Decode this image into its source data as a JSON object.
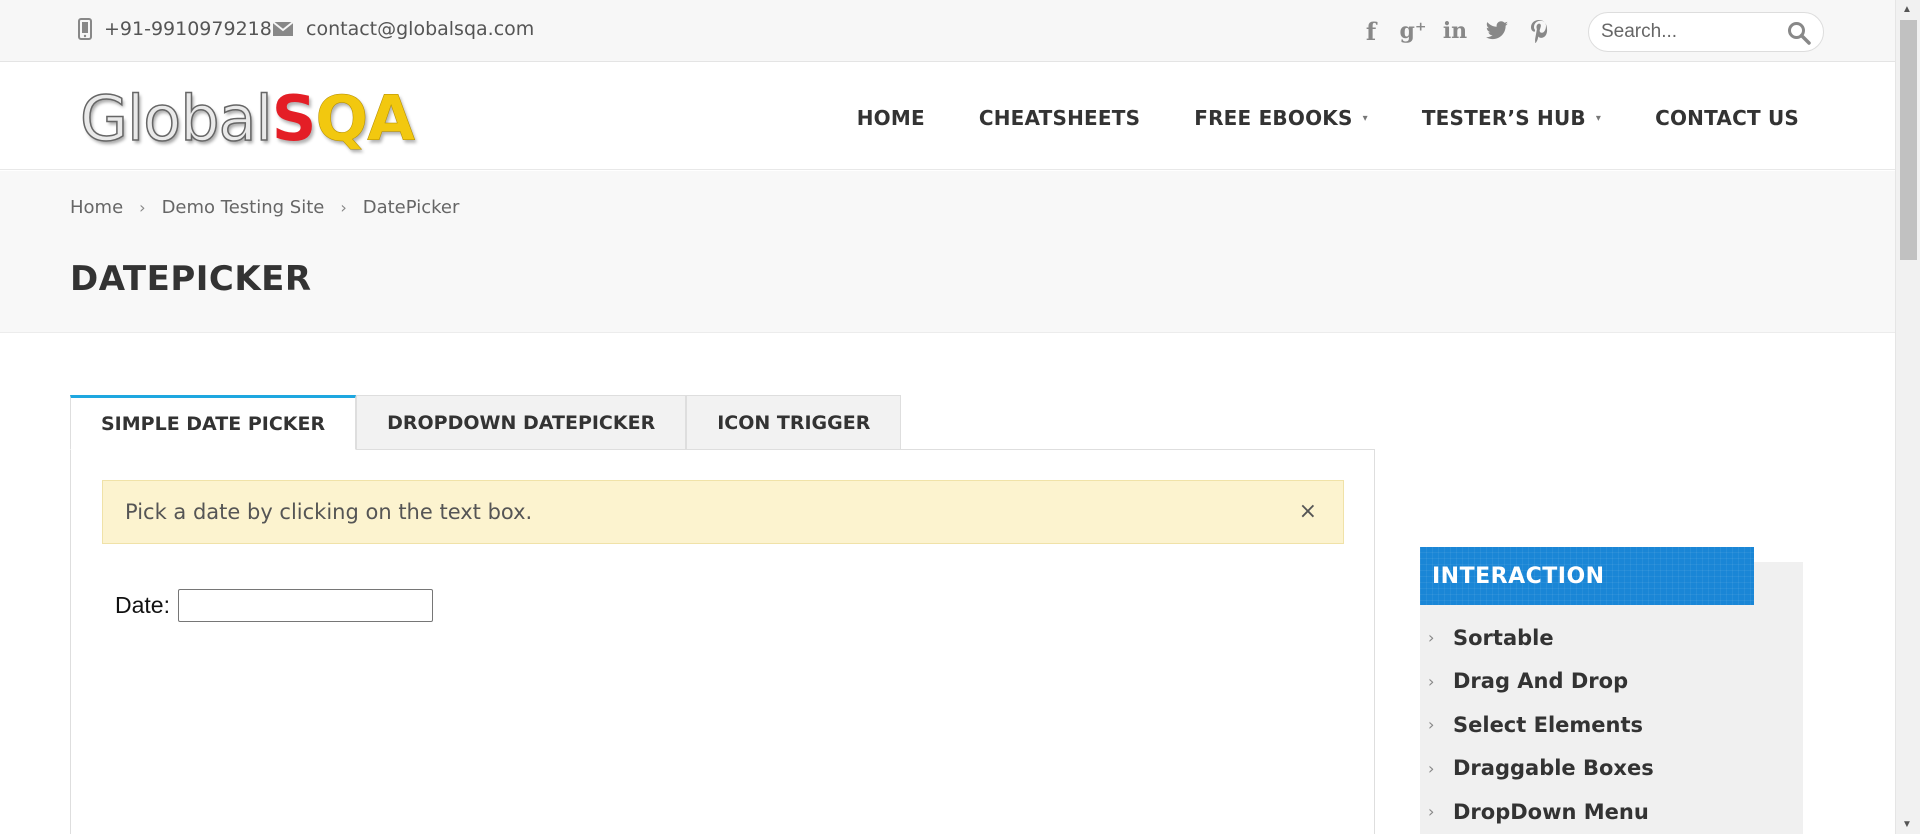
{
  "topbar": {
    "phone": "+91-9910979218",
    "email": "contact@globalsqa.com",
    "social": [
      {
        "name": "facebook-icon",
        "glyph": "f"
      },
      {
        "name": "google-plus-icon",
        "glyph": "g⁺"
      },
      {
        "name": "linkedin-icon",
        "glyph": "in"
      },
      {
        "name": "twitter-icon",
        "glyph": "🐦"
      },
      {
        "name": "pinterest-icon",
        "glyph": "p"
      }
    ],
    "search_placeholder": "Search..."
  },
  "logo": {
    "part1": "Global",
    "part2": "S",
    "part3": "QA"
  },
  "nav": {
    "home": "HOME",
    "cheatsheets": "CHEATSHEETS",
    "free_ebooks": "FREE EBOOKS",
    "testers_hub": "TESTER’S HUB",
    "contact_us": "CONTACT US"
  },
  "breadcrumb": {
    "home": "Home",
    "demo": "Demo Testing Site",
    "current": "DatePicker"
  },
  "page_title": "DATEPICKER",
  "tabs": {
    "simple": "SIMPLE DATE PICKER",
    "dropdown": "DROPDOWN DATEPICKER",
    "icon": "ICON TRIGGER"
  },
  "alert": {
    "text": "Pick a date by clicking on the text box.",
    "close": "×"
  },
  "date_field": {
    "label": "Date:",
    "value": ""
  },
  "sidebar": {
    "heading": "INTERACTION",
    "items": [
      "Sortable",
      "Drag And Drop",
      "Select Elements",
      "Draggable Boxes",
      "DropDown Menu"
    ]
  },
  "colors": {
    "accent": "#1ea7e0",
    "widget_blue": "#1a86d6",
    "alert_bg": "#fcf3cf",
    "logo_red": "#e41e26",
    "logo_yellow": "#f2c80f"
  }
}
